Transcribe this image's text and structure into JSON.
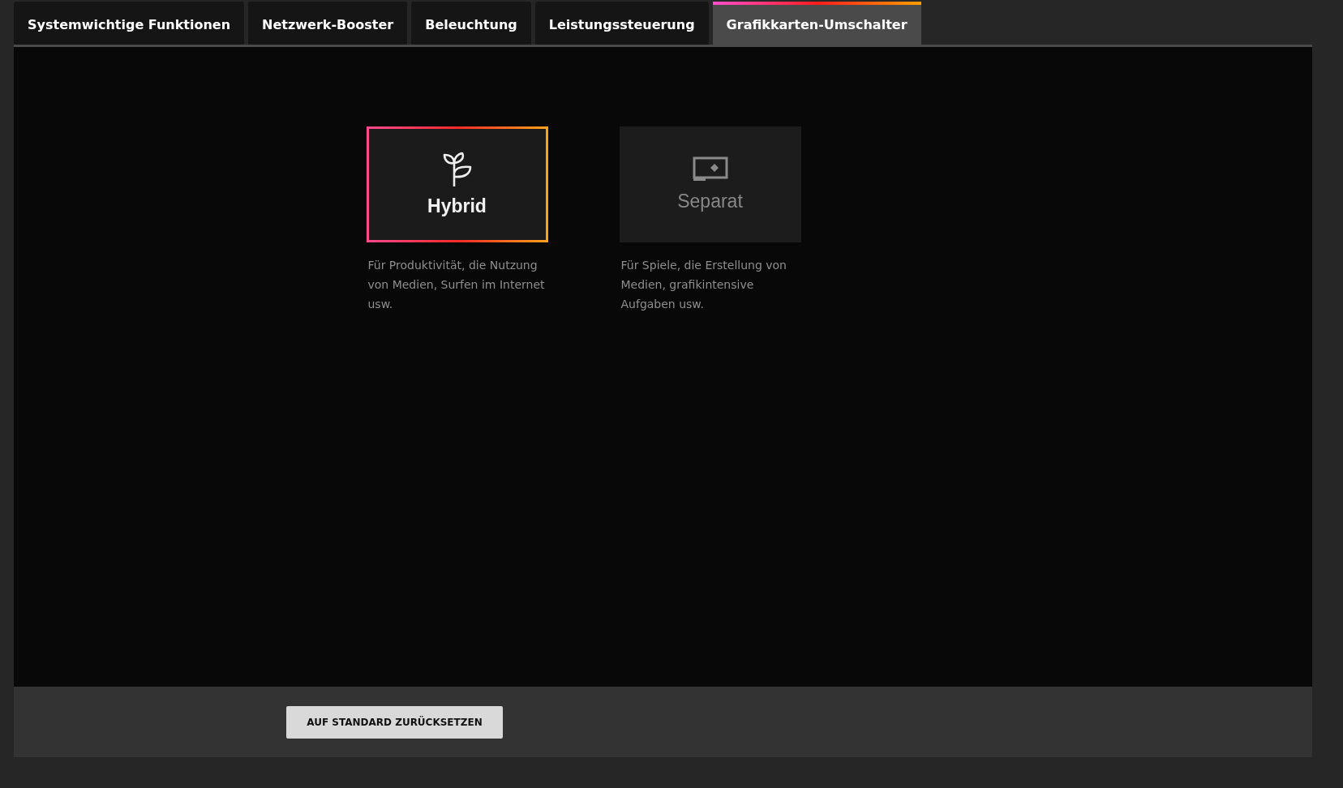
{
  "tabs": [
    {
      "label": "Systemwichtige Funktionen",
      "selected": false
    },
    {
      "label": "Netzwerk-Booster",
      "selected": false
    },
    {
      "label": "Beleuchtung",
      "selected": false
    },
    {
      "label": "Leistungssteuerung",
      "selected": false
    },
    {
      "label": "Grafikkarten-Umschalter",
      "selected": true
    }
  ],
  "modes": [
    {
      "kind": "hybrid",
      "label": "Hybrid",
      "selected": true,
      "description": "Für Produktivität, die Nutzung von Medien, Surfen im Internet usw."
    },
    {
      "kind": "separate",
      "label": "Separat",
      "selected": false,
      "description": "Für Spiele, die Erstellung von Medien, grafikintensive Aufgaben usw."
    }
  ],
  "footer": {
    "reset_button": "AUF STANDARD ZURÜCKSETZEN"
  }
}
